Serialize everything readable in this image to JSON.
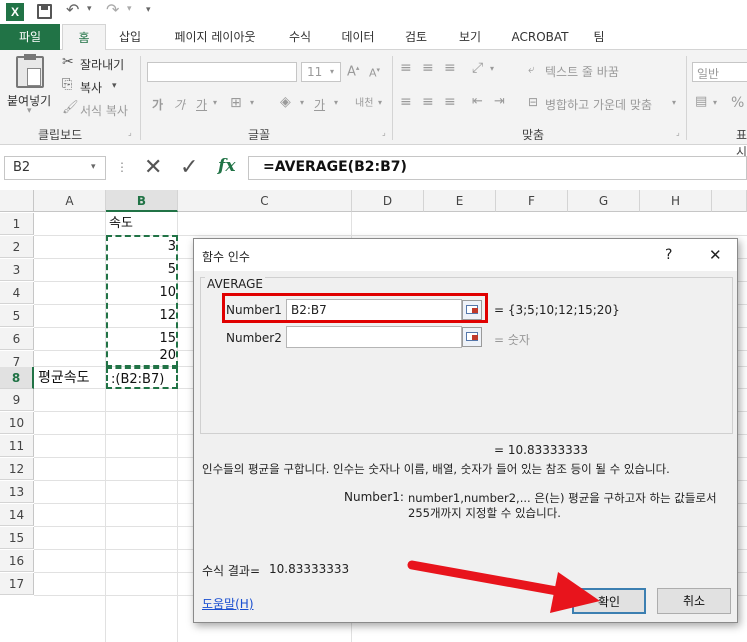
{
  "tabs": [
    "파일",
    "홈",
    "삽입",
    "페이지 레이아웃",
    "수식",
    "데이터",
    "검토",
    "보기",
    "ACROBAT",
    "팀"
  ],
  "ribbon": {
    "paste_label": "붙여넣기",
    "cut_label": "잘라내기",
    "copy_label": "복사",
    "format_painter_label": "서식 복사",
    "clipboard_group": "클립보드",
    "font_size": "11",
    "font_group": "글꼴",
    "bold": "가",
    "italic": "가",
    "underline": "가",
    "font_color": "가",
    "text_direction": "내천",
    "wrap_text_label": "텍스트 줄 바꿈",
    "merge_label": "병합하고 가운데 맞춤",
    "align_group": "맞춤",
    "number_format": "일반",
    "number_group": "표시",
    "percent": "%"
  },
  "formula_bar": {
    "name_box": "B2",
    "fx": "fx",
    "formula": "=AVERAGE(B2:B7)"
  },
  "sheet": {
    "columns": [
      "A",
      "B",
      "C",
      "D",
      "E",
      "F",
      "G",
      "H"
    ],
    "rows": [
      "1",
      "2",
      "3",
      "4",
      "5",
      "6",
      "7",
      "8",
      "9",
      "10",
      "11",
      "12",
      "13",
      "14",
      "15",
      "16",
      "17"
    ],
    "b1": "속도",
    "b_values": [
      "3",
      "5",
      "10",
      "12",
      "15",
      "20"
    ],
    "a8": "평균속도",
    "b8": ":(B2:B7)"
  },
  "dialog": {
    "title": "함수 인수",
    "help_q": "?",
    "close_icon": "✕",
    "function_name": "AVERAGE",
    "arg1_label": "Number1",
    "arg1_value": "B2:B7",
    "arg1_result": "= {3;5;10;12;15;20}",
    "arg2_label": "Number2",
    "arg2_value": "",
    "arg2_result": "= 숫자",
    "result_preview": "= 10.83333333",
    "description": "인수들의 평균을 구합니다. 인수는 숫자나 이름, 배열, 숫자가 들어 있는 참조 등이 될 수 있습니다.",
    "arg_help_label": "Number1:",
    "arg_help_line1": "number1,number2,... 은(는) 평균을 구하고자 하는 값들로서",
    "arg_help_line2": "255개까지 지정할 수 있습니다.",
    "formula_result_label": "수식 결과=",
    "formula_result_value": "10.83333333",
    "help_link": "도움말(H)",
    "ok_label": "확인",
    "cancel_label": "취소"
  },
  "colors": {
    "excel_green": "#217346",
    "highlight_red": "#e00000",
    "arrow_red": "#e8141c"
  }
}
